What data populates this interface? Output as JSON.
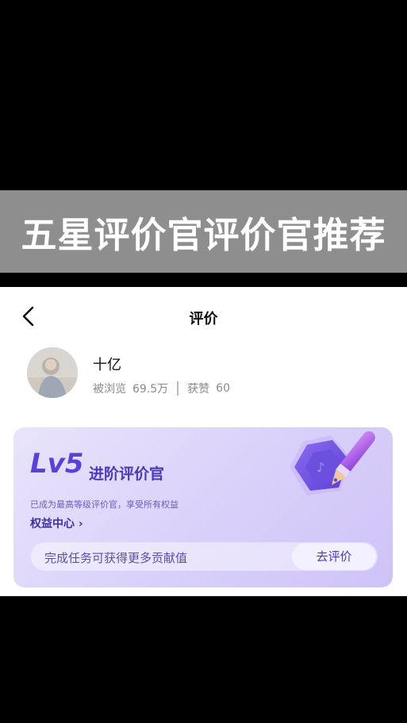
{
  "banner": {
    "text": "五星评价官评价官推荐"
  },
  "nav": {
    "title": "评价",
    "back_icon": "chevron-left-icon"
  },
  "profile": {
    "name": "十亿",
    "views_label": "被浏览",
    "views_value": "69.5万",
    "likes_label": "获赞",
    "likes_value": "60"
  },
  "level_card": {
    "level": "Lv5",
    "title": "进阶评价官",
    "description": "已成为最高等级评价官，享受所有权益",
    "rights_link": "权益中心",
    "task_text": "完成任务可获得更多贡献值",
    "task_button": "去评价",
    "badge_icon": "pen-badge-icon",
    "accent_color": "#5a41d8"
  }
}
